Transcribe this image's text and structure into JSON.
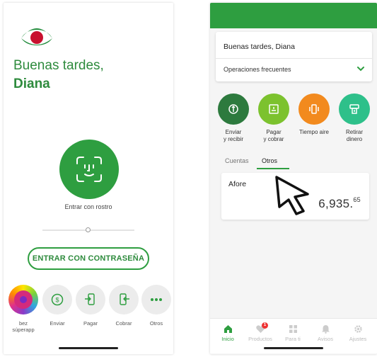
{
  "login": {
    "greeting_line1": "Buenas tardes,",
    "greeting_name": "Diana",
    "face_label": "Entrar con rostro",
    "password_button": "ENTRAR CON CONTRASEÑA",
    "quick_actions": [
      {
        "label": "bez\nsúperapp",
        "icon": "bez-superapp-icon"
      },
      {
        "label": "Enviar",
        "icon": "dollar-transfer-icon"
      },
      {
        "label": "Pagar",
        "icon": "phone-pay-icon"
      },
      {
        "label": "Cobrar",
        "icon": "phone-collect-icon"
      },
      {
        "label": "Otros",
        "icon": "more-dots-icon"
      }
    ],
    "colors": {
      "brand_green": "#2e9e40",
      "logo_red": "#c8102e"
    }
  },
  "home": {
    "greeting": "Buenas tardes, Diana",
    "frequent_ops": "Operaciones frecuentes",
    "operations": [
      {
        "label": "Enviar\ny recibir",
        "color": "#2d7a3e"
      },
      {
        "label": "Pagar\ny cobrar",
        "color": "#7cc22e"
      },
      {
        "label": "Tiempo aire",
        "color": "#f28a1e"
      },
      {
        "label": "Retirar\ndinero",
        "color": "#2ec08a"
      }
    ],
    "tabs": {
      "cuentas": "Cuentas",
      "otros": "Otros",
      "active": "Otros"
    },
    "afore": {
      "title": "Afore",
      "amount_main": "6,935.",
      "amount_cents": "65"
    },
    "bottom_nav": [
      {
        "label": "Inicio",
        "icon": "home-icon",
        "active": true
      },
      {
        "label": "Productos",
        "icon": "products-icon",
        "badge": "1"
      },
      {
        "label": "Para ti",
        "icon": "grid-icon"
      },
      {
        "label": "Avisos",
        "icon": "bell-icon"
      },
      {
        "label": "Ajustes",
        "icon": "gear-icon"
      }
    ]
  }
}
